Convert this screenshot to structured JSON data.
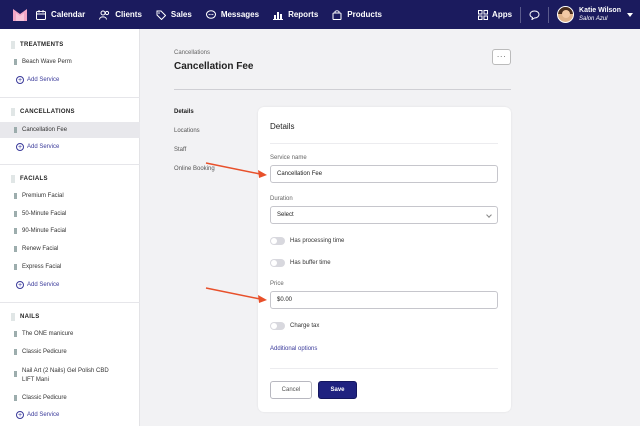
{
  "nav": {
    "items": [
      {
        "label": "Calendar",
        "icon": "calendar-icon"
      },
      {
        "label": "Clients",
        "icon": "clients-icon"
      },
      {
        "label": "Sales",
        "icon": "tag-icon"
      },
      {
        "label": "Messages",
        "icon": "chat-bubble-icon"
      },
      {
        "label": "Reports",
        "icon": "bar-chart-icon"
      },
      {
        "label": "Products",
        "icon": "bag-icon"
      }
    ],
    "apps_label": "Apps",
    "user": {
      "name": "Katie Wilson",
      "subtitle": "Salon Azul"
    }
  },
  "sidebar": {
    "categories": [
      {
        "name": "TREATMENTS",
        "services": [
          "Beach Wave Perm"
        ],
        "add_label": "Add Service"
      },
      {
        "name": "CANCELLATIONS",
        "services": [
          "Cancellation Fee"
        ],
        "add_label": "Add Service"
      },
      {
        "name": "FACIALS",
        "services": [
          "Premium Facial",
          "50-Minute Facial",
          "90-Minute Facial",
          "Renew Facial",
          "Express Facial"
        ],
        "add_label": "Add Service"
      },
      {
        "name": "NAILS",
        "services": [
          "The ONE manicure",
          "Classic Pedicure",
          "Nail Art (2 Nails) Gel Polish CBD",
          "LIFT Mani",
          "Classic Pedicure"
        ],
        "add_label": "Add Service"
      }
    ],
    "active_service": "Cancellation Fee"
  },
  "main": {
    "breadcrumb": "Cancellations",
    "title": "Cancellation Fee",
    "more_label": "···",
    "subnav": [
      "Details",
      "Locations",
      "Staff",
      "Online Booking"
    ]
  },
  "form": {
    "title": "Details",
    "service_name_label": "Service name",
    "service_name_value": "Cancellation Fee",
    "duration_label": "Duration",
    "duration_value": "Select",
    "processing_label": "Has processing time",
    "buffer_label": "Has buffer time",
    "price_label": "Price",
    "price_value": "$0.00",
    "charge_tax_label": "Charge tax",
    "additional_options_label": "Additional options",
    "cancel_label": "Cancel",
    "save_label": "Save"
  },
  "colors": {
    "nav_bg": "#1b1b5e",
    "accent": "#1f2280",
    "link": "#3a3a9a",
    "arrow": "#e8502a"
  }
}
